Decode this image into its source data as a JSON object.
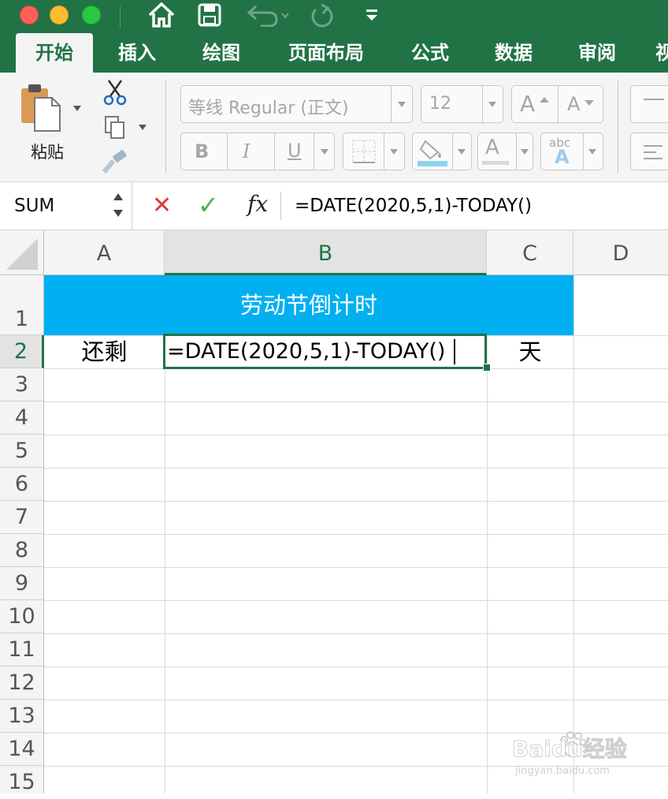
{
  "colors": {
    "accent": "#217346",
    "header_fill": "#00b0f0",
    "cancel": "#e03a3a",
    "enter": "#4caf50"
  },
  "toolbar": {
    "icons": [
      "close-light",
      "minimize-light",
      "zoom-light",
      "home-icon",
      "save-icon",
      "undo-icon",
      "redo-icon",
      "customize-icon"
    ]
  },
  "tabs": [
    "开始",
    "插入",
    "绘图",
    "页面布局",
    "公式",
    "数据",
    "审阅",
    "视"
  ],
  "ribbon": {
    "paste_label": "粘贴",
    "font_name_placeholder": "等线 Regular (正文)",
    "font_size": "12",
    "bold_label": "B",
    "italic_label": "I",
    "underline_label": "U",
    "grow_font": "A",
    "shrink_font": "A",
    "font_color": "A",
    "abc_label": "abc",
    "abc_sub": "A"
  },
  "formula_bar": {
    "name_box": "SUM",
    "cancel": "✕",
    "enter": "✓",
    "fx": "fx",
    "formula": "=DATE(2020,5,1)-TODAY()"
  },
  "columns": [
    "A",
    "B",
    "C",
    "D"
  ],
  "rows": [
    "1",
    "2",
    "3",
    "4",
    "5",
    "6",
    "7",
    "8",
    "9",
    "10",
    "11",
    "12",
    "13",
    "14",
    "15"
  ],
  "cells": {
    "title": "劳动节倒计时",
    "a2": "还剩",
    "b2": "=DATE(2020,5,1)-TODAY()",
    "c2": "天"
  },
  "watermark": {
    "brand": "Baidu经验",
    "url": "jingyan.baidu.com"
  }
}
